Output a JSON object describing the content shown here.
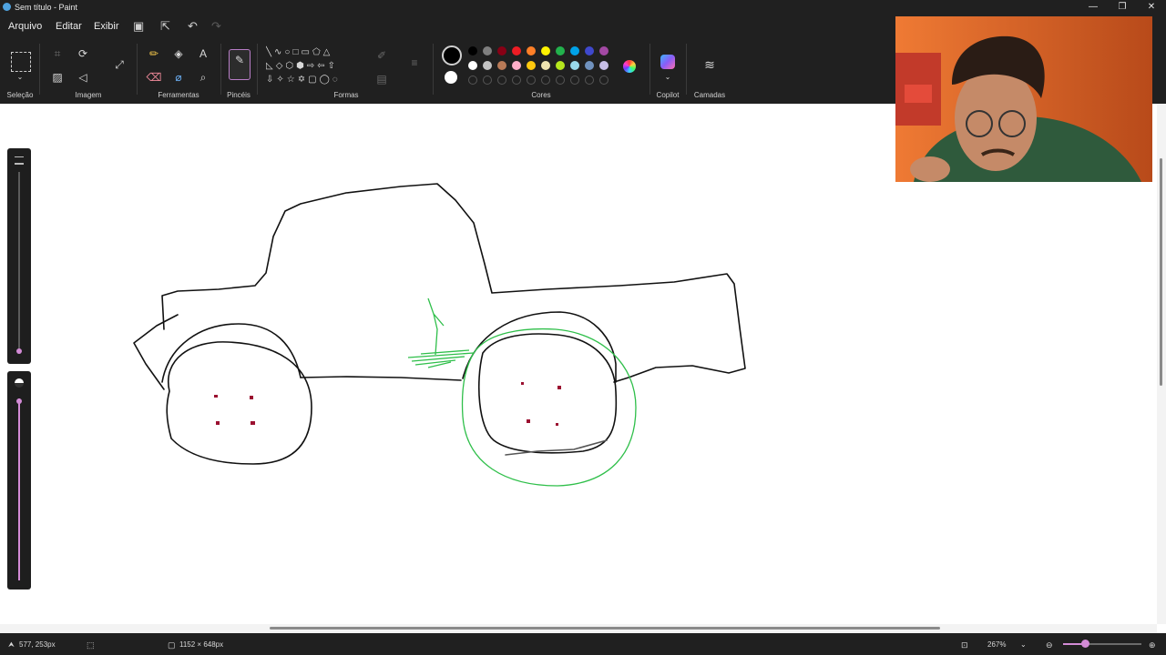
{
  "window": {
    "title": "Sem título - Paint",
    "controls": [
      "—",
      "❐",
      "✕"
    ]
  },
  "menu": {
    "items": [
      "Arquivo",
      "Editar",
      "Exibir"
    ]
  },
  "ribbon": {
    "groups": {
      "selection": "Seleção",
      "image": "Imagem",
      "tools": "Ferramentas",
      "brushes": "Pincéis",
      "shapes": "Formas",
      "colors": "Cores",
      "copilot": "Copilot",
      "layers": "Camadas"
    },
    "icons": {
      "select": "▢",
      "crop": "⌗",
      "rotate": "⟳",
      "resize": "⤢",
      "pencil": "✏",
      "fill": "◈",
      "text": "A",
      "eraser": "⌫",
      "picker": "⌀",
      "zoom": "⌕",
      "brush": "✎",
      "layers": "≋"
    },
    "shape_glyphs": [
      "╲",
      "∿",
      "○",
      "□",
      "▭",
      "⬠",
      "△",
      "◺",
      "◇",
      "⬡",
      "⬢",
      "⇨",
      "⇦",
      "⇧",
      "⇩",
      "✧",
      "☆",
      "✡",
      "▢",
      "◯",
      "◌"
    ],
    "colors": {
      "primary": "#000000",
      "secondary": "#ffffff",
      "row1": [
        "#000000",
        "#7f7f7f",
        "#880015",
        "#ed1c24",
        "#ff7f27",
        "#fff200",
        "#22b14c",
        "#00a2e8",
        "#3f48cc",
        "#a349a4"
      ],
      "row2": [
        "#ffffff",
        "#c3c3c3",
        "#b97a57",
        "#ffaec9",
        "#ffc90e",
        "#efe4b0",
        "#b5e61d",
        "#99d9ea",
        "#7092be",
        "#c8bfe7"
      ]
    }
  },
  "status": {
    "cursor_pos": "577, 253px",
    "canvas_size": "1152 × 648px",
    "zoom": "267%"
  },
  "theme": {
    "chrome": "#202020",
    "accent": "#d38bd6",
    "stroke_black": "#111111",
    "stroke_green": "#2fbf4a",
    "dot_red": "#9b1030"
  }
}
